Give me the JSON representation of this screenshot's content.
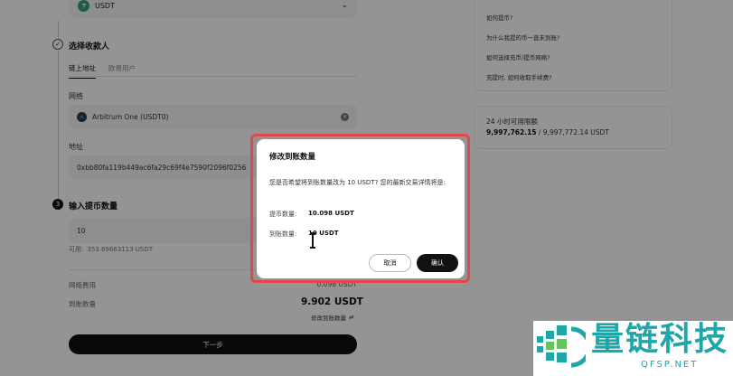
{
  "coin": {
    "label": "USDT",
    "icon": "tether-icon"
  },
  "steps": {
    "recipient": {
      "title": "选择收款人"
    },
    "amount": {
      "number": "3",
      "title": "输入提币数量"
    }
  },
  "tabs": [
    {
      "label": "链上地址",
      "active": true
    },
    {
      "label": "欧易用户",
      "active": false
    }
  ],
  "network": {
    "label": "网络",
    "value": "Arbitrum One (USDT0)"
  },
  "address": {
    "label": "地址",
    "value": "0xbb80fa119b449ac6fa29c69f4e7590f2096f0256"
  },
  "amount": {
    "value": "10",
    "available_label": "可用:",
    "available_value": "353.69663113 USDT"
  },
  "summary": {
    "fee_label": "网络费用",
    "fee_value": "0.098 USDT",
    "receive_label": "到账数量",
    "receive_value": "9.902 USDT",
    "modify_link": "修改到账数量"
  },
  "next_button": "下一步",
  "faq": [
    "如何提币?",
    "为什么我提的币一直未到账?",
    "如何选择充币/提币网络?",
    "充提时, 如何收取手续费?"
  ],
  "limit": {
    "title": "24 小时可用限额",
    "value_bold": "9,997,762.15",
    "value_rest": " / 9,997,772.14 USDT"
  },
  "modal": {
    "title": "修改到账数量",
    "message": "您是否希望将到账数量改为 10 USDT? 您的最新交易详情将是:",
    "withdraw_label": "提币数量:",
    "withdraw_value": "10.098 USDT",
    "receive_label": "到账数量:",
    "receive_value": "10 USDT",
    "cancel": "取消",
    "confirm": "确认"
  },
  "watermark": {
    "text": "量链科技",
    "sub": "QFSP.NET"
  },
  "colors": {
    "accent": "#111111",
    "highlight_border": "#e2474e",
    "watermark": "#1fa6a8",
    "coin": "#2aa37a"
  }
}
